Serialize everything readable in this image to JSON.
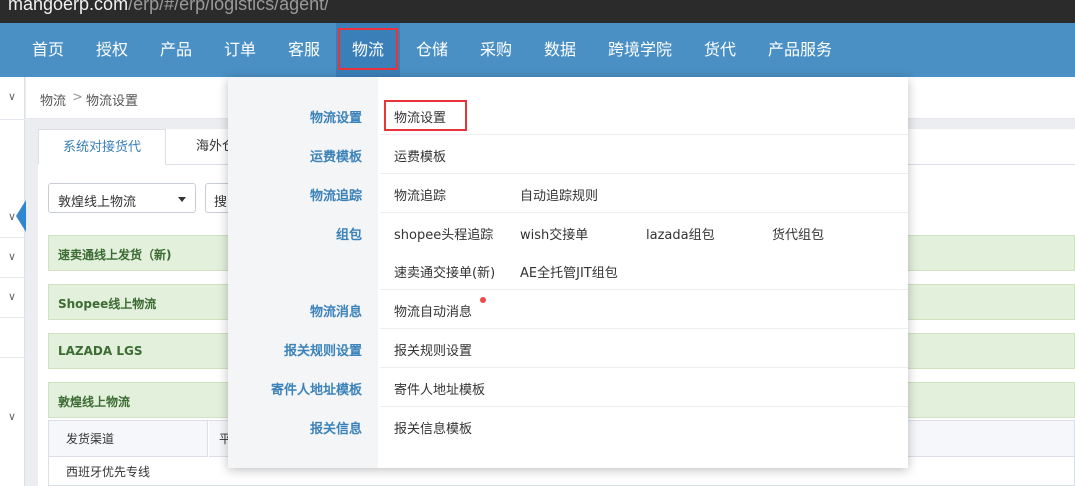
{
  "browser": {
    "url_host": "mangoerp.com",
    "url_path": "/erp/#/erp/logistics/agent/"
  },
  "nav": {
    "items": [
      {
        "label": "首页"
      },
      {
        "label": "授权"
      },
      {
        "label": "产品"
      },
      {
        "label": "订单"
      },
      {
        "label": "客服"
      },
      {
        "label": "物流"
      },
      {
        "label": "仓储"
      },
      {
        "label": "采购"
      },
      {
        "label": "数据"
      },
      {
        "label": "跨境学院"
      },
      {
        "label": "货代"
      },
      {
        "label": "产品服务"
      }
    ],
    "active": "物流"
  },
  "breadcrumb": {
    "items": [
      "物流",
      "物流设置"
    ],
    "separator": ">"
  },
  "main": {
    "tabs": [
      {
        "label": "系统对接货代"
      },
      {
        "label": "海外仓"
      }
    ],
    "filter_select": "敦煌线上物流",
    "search_select": "搜",
    "groups": [
      {
        "label": "速卖通线上发货（新)"
      },
      {
        "label": "Shopee线上物流"
      },
      {
        "label": "LAZADA LGS"
      },
      {
        "label": "敦煌线上物流"
      }
    ],
    "table": {
      "headers": [
        "发货渠道",
        "平"
      ],
      "rows": [
        [
          "西班牙优先专线"
        ]
      ]
    }
  },
  "menu": {
    "categories": [
      {
        "label": "物流设置",
        "links": [
          "物流设置"
        ]
      },
      {
        "label": "运费模板",
        "links": [
          "运费模板"
        ]
      },
      {
        "label": "物流追踪",
        "links": [
          "物流追踪",
          "自动追踪规则"
        ]
      },
      {
        "label": "组包",
        "links": [
          "shopee头程追踪",
          "wish交接单",
          "lazada组包",
          "货代组包",
          "速卖通交接单(新)",
          "AE全托管JIT组包"
        ]
      },
      {
        "label": "物流消息",
        "links": [
          "物流自动消息"
        ]
      },
      {
        "label": "报关规则设置",
        "links": [
          "报关规则设置"
        ]
      },
      {
        "label": "寄件人地址模板",
        "links": [
          "寄件人地址模板"
        ]
      },
      {
        "label": "报关信息",
        "links": [
          "报关信息模板"
        ]
      }
    ],
    "highlighted_link": "物流设置",
    "new_badge_on": "物流自动消息"
  },
  "colors": {
    "nav_bg": "#4a90c4",
    "accent_red": "#e8333a",
    "category_blue": "#3b82b9",
    "group_green": "#e3f0dc"
  }
}
